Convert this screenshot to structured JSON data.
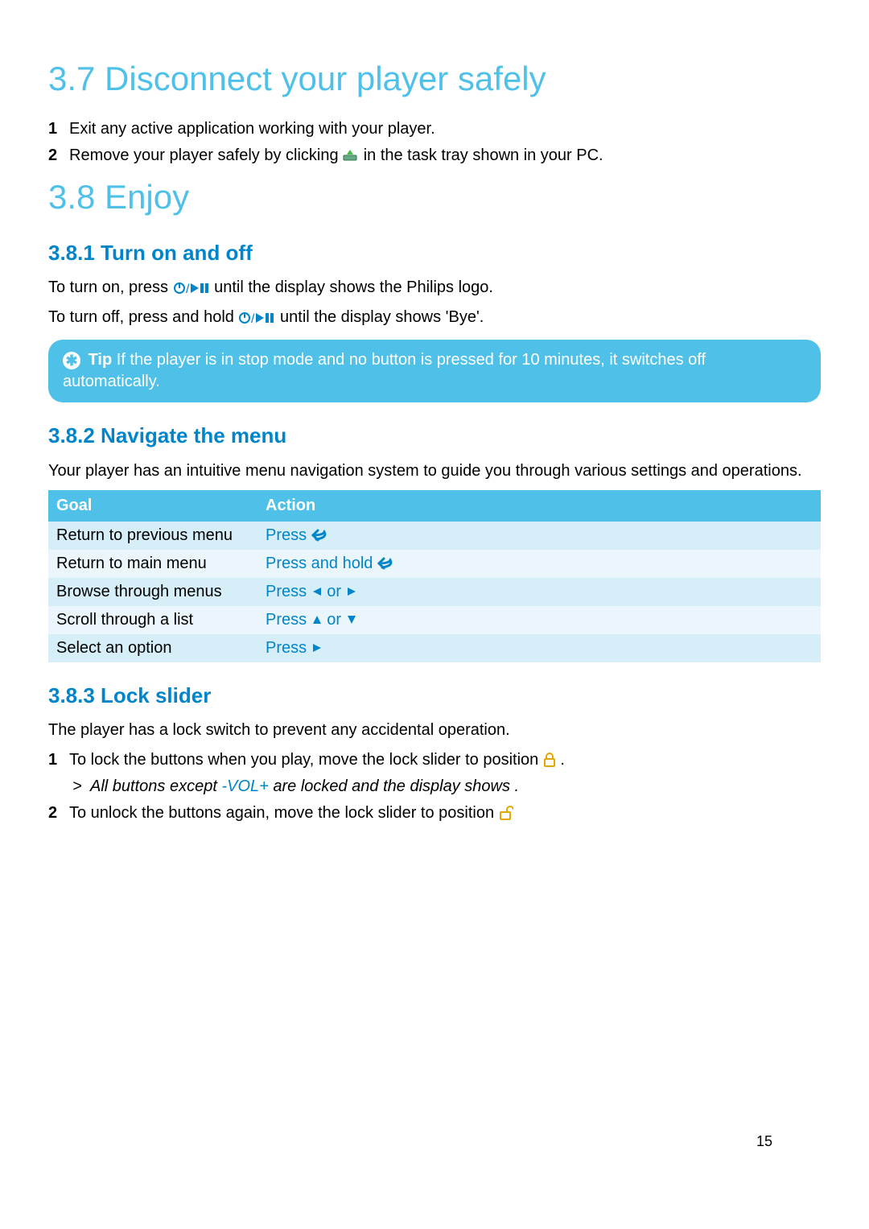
{
  "section37": {
    "heading": "3.7 Disconnect your player safely",
    "steps": [
      "Exit any active application working with your player.",
      [
        "Remove your player safely by clicking ",
        "remove-hardware-icon",
        " in the task tray shown in your PC."
      ]
    ]
  },
  "section38": {
    "heading": "3.8 Enjoy",
    "s381": {
      "heading": "3.8.1 Turn on and off",
      "p1_parts": [
        "To turn on, press ",
        "power-play-icon",
        " until the display shows the Philips logo."
      ],
      "p2_parts": [
        "To turn off, press and hold ",
        "power-play-icon",
        " until the display shows 'Bye'."
      ],
      "tip_label": "Tip",
      "tip_text": " If the player is in stop mode and no button is pressed for 10 minutes, it switches off automatically."
    },
    "s382": {
      "heading": "3.8.2 Navigate the menu",
      "intro": "Your player has an intuitive menu navigation system to guide you through various settings and operations.",
      "cols": {
        "goal": "Goal",
        "action": "Action"
      },
      "rows": [
        {
          "goal": "Return to previous menu",
          "action_text": "Press ",
          "icons": [
            "back-icon"
          ]
        },
        {
          "goal": "Return to main menu",
          "action_text": "Press and hold ",
          "icons": [
            "back-icon"
          ]
        },
        {
          "goal": "Browse through menus",
          "action_text": "Press ",
          "mid": " or ",
          "icons": [
            "left-icon",
            "right-icon"
          ]
        },
        {
          "goal": "Scroll through a list",
          "action_text": "Press ",
          "mid": " or ",
          "icons": [
            "up-icon",
            "down-icon"
          ]
        },
        {
          "goal": "Select an option",
          "action_text": "Press ",
          "icons": [
            "right-icon"
          ]
        }
      ]
    },
    "s383": {
      "heading": "3.8.3 Lock slider",
      "intro": "The player has a lock switch to prevent any accidental operation.",
      "step1_parts": [
        "To lock the buttons when you play, move the lock slider to position ",
        "lock-closed-icon",
        " ."
      ],
      "result": {
        "pre": "All buttons except ",
        "vol": "-VOL+",
        "post": " are locked and the display shows     ."
      },
      "step2_parts": [
        "To unlock the buttons again, move the lock slider to position ",
        "lock-open-icon"
      ]
    }
  },
  "page_number": "15",
  "chart_data": {
    "type": "table",
    "title": "Menu navigation actions",
    "columns": [
      "Goal",
      "Action"
    ],
    "rows": [
      [
        "Return to previous menu",
        "Press [back]"
      ],
      [
        "Return to main menu",
        "Press and hold [back]"
      ],
      [
        "Browse through menus",
        "Press [left] or [right]"
      ],
      [
        "Scroll through a list",
        "Press [up] or [down]"
      ],
      [
        "Select an option",
        "Press [right]"
      ]
    ]
  }
}
